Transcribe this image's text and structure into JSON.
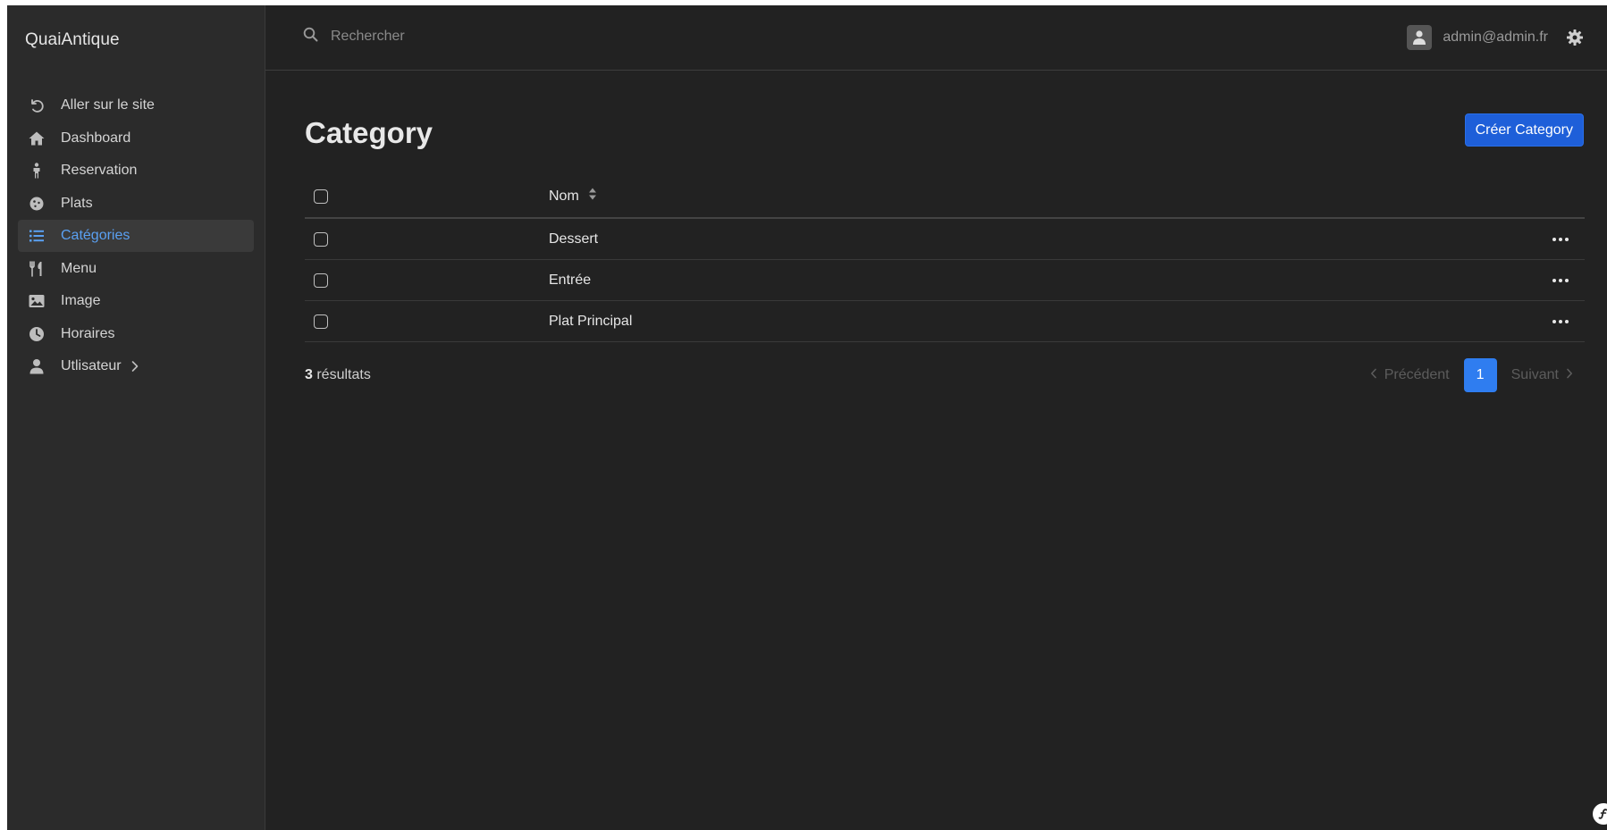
{
  "app": {
    "brand": "QuaiAntique"
  },
  "sidebar": {
    "items": [
      {
        "label": "Aller sur le site",
        "icon": "undo-icon",
        "active": false
      },
      {
        "label": "Dashboard",
        "icon": "home-icon",
        "active": false
      },
      {
        "label": "Reservation",
        "icon": "person-icon",
        "active": false
      },
      {
        "label": "Plats",
        "icon": "cookie-icon",
        "active": false
      },
      {
        "label": "Catégories",
        "icon": "list-icon",
        "active": true
      },
      {
        "label": "Menu",
        "icon": "utensils-icon",
        "active": false
      },
      {
        "label": "Image",
        "icon": "image-icon",
        "active": false
      },
      {
        "label": "Horaires",
        "icon": "clock-icon",
        "active": false
      },
      {
        "label": "Utlisateur",
        "icon": "user-icon",
        "active": false,
        "has_submenu": true
      }
    ]
  },
  "topbar": {
    "search_placeholder": "Rechercher",
    "user_email": "admin@admin.fr"
  },
  "main": {
    "title": "Category",
    "create_button_label": "Créer Category",
    "table": {
      "column_name": "Nom",
      "rows": [
        {
          "name": "Dessert"
        },
        {
          "name": "Entrée"
        },
        {
          "name": "Plat Principal"
        }
      ]
    },
    "results_count": "3",
    "results_label": " résultats",
    "pagination": {
      "previous_label": "Précédent",
      "current_page": "1",
      "next_label": "Suivant"
    }
  },
  "colors": {
    "background": "#222222",
    "sidebar_background": "#2b2b2b",
    "accent": "#1e5fd9",
    "active_link": "#5aa0f2"
  }
}
